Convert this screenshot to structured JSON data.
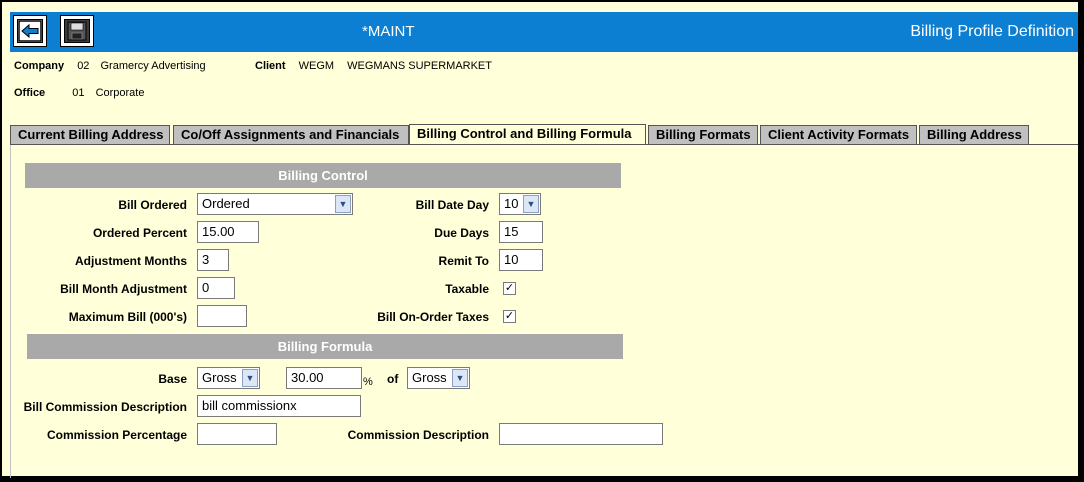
{
  "header": {
    "maint": "*MAINT",
    "title": "Billing Profile Definition",
    "buttons": [
      {
        "icon": "back-arrow-icon"
      },
      {
        "icon": "save-disk-icon"
      }
    ]
  },
  "info": {
    "company_label": "Company",
    "company_code": "02",
    "company_name": "Gramercy Advertising",
    "client_label": "Client",
    "client_code": "WEGM",
    "client_name": "WEGMANS SUPERMARKET",
    "office_label": "Office",
    "office_code": "01",
    "office_name": "Corporate"
  },
  "tabs": [
    "Current Billing Address",
    "Co/Off Assignments and Financials",
    "Billing Control and Billing Formula",
    "Billing Formats",
    "Client Activity Formats",
    "Billing Address"
  ],
  "billing_control": {
    "title": "Billing Control",
    "bill_ordered_label": "Bill Ordered",
    "bill_ordered_value": "Ordered",
    "ordered_percent_label": "Ordered Percent",
    "ordered_percent_value": "15.00",
    "adjustment_months_label": "Adjustment Months",
    "adjustment_months_value": "3",
    "bill_month_adjustment_label": "Bill Month Adjustment",
    "bill_month_adjustment_value": "0",
    "maximum_bill_label": "Maximum Bill (000's)",
    "maximum_bill_value": "",
    "bill_date_day_label": "Bill Date Day",
    "bill_date_day_value": "10",
    "due_days_label": "Due Days",
    "due_days_value": "15",
    "remit_to_label": "Remit To",
    "remit_to_value": "10",
    "taxable_label": "Taxable",
    "taxable_checked": true,
    "bill_on_order_taxes_label": "Bill On-Order Taxes",
    "bill_on_order_taxes_checked": true
  },
  "billing_formula": {
    "title": "Billing Formula",
    "base_label": "Base",
    "base_value": "Gross",
    "percent_value": "30.00",
    "percent_sign": "%",
    "of_label": "of",
    "of_value": "Gross",
    "bill_commission_description_label": "Bill Commission Description",
    "bill_commission_description_value": "bill commissionx",
    "commission_percentage_label": "Commission Percentage",
    "commission_percentage_value": "",
    "commission_description_label": "Commission Description",
    "commission_description_value": ""
  },
  "colors": {
    "header_blue": "#0d7fd2",
    "page_bg": "#ffffd9",
    "section_gray": "#a9a9a9",
    "tab_gray": "#c0c0c0"
  }
}
